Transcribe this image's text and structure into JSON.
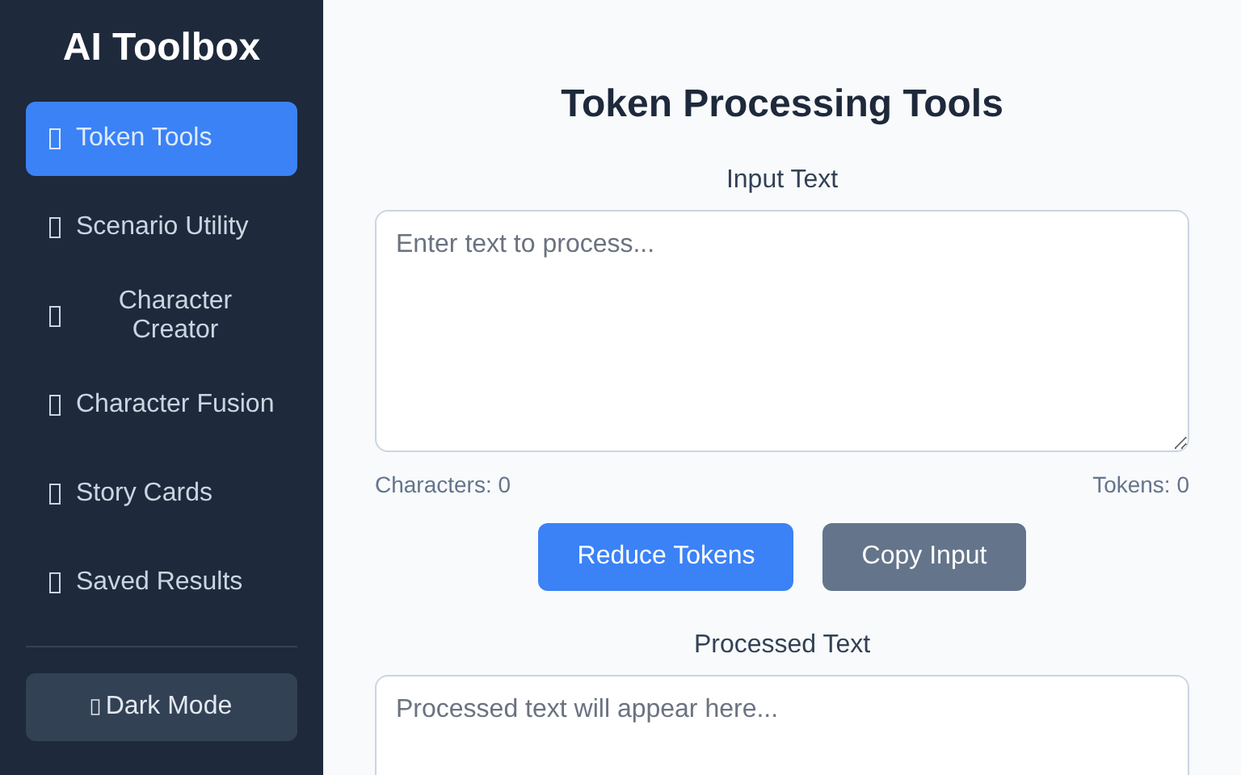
{
  "sidebar": {
    "title": "AI Toolbox",
    "items": [
      {
        "label": "Token Tools",
        "selected": true
      },
      {
        "label": "Scenario Utility",
        "selected": false
      },
      {
        "label": "Character\nCreator",
        "selected": false
      },
      {
        "label": "Character Fusion",
        "selected": false
      },
      {
        "label": "Story Cards",
        "selected": false
      },
      {
        "label": "Saved Results",
        "selected": false
      }
    ],
    "theme_button": "Dark Mode"
  },
  "main": {
    "heading": "Token Processing Tools",
    "input": {
      "label": "Input Text",
      "placeholder": "Enter text to process..."
    },
    "counts": {
      "characters": "Characters: 0",
      "tokens": "Tokens: 0"
    },
    "buttons": [
      {
        "label": "Reduce Tokens",
        "kind": "primary"
      },
      {
        "label": "Copy Input",
        "kind": "secondary"
      }
    ],
    "output": {
      "label": "Processed Text",
      "placeholder": "Processed text will appear here..."
    }
  }
}
